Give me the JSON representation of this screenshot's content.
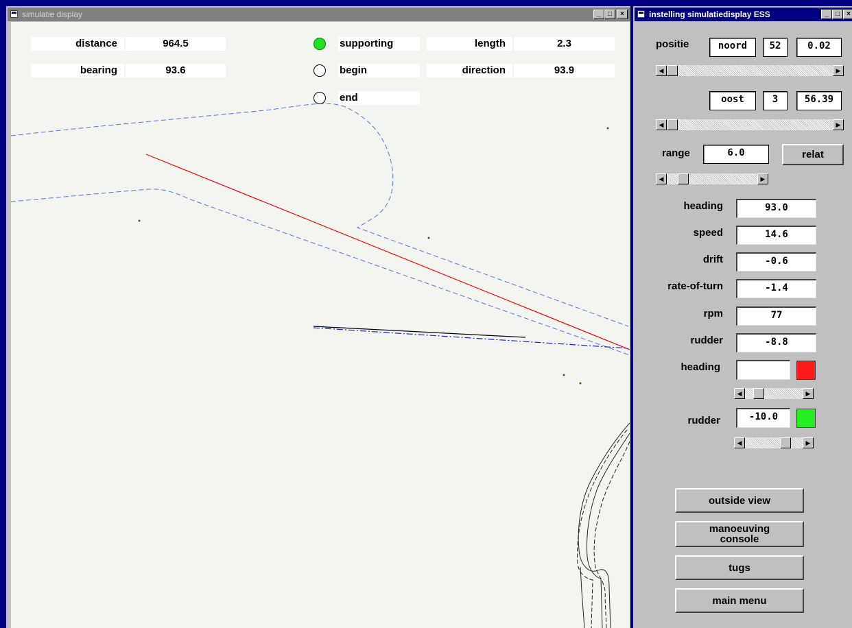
{
  "sim": {
    "title": "simulatie display",
    "info": {
      "distance_label": "distance",
      "distance_value": "964.5",
      "bearing_label": "bearing",
      "bearing_value": "93.6",
      "length_label": "length",
      "length_value": "2.3",
      "direction_label": "direction",
      "direction_value": "93.9"
    },
    "modes": [
      {
        "label": "supporting",
        "selected": true
      },
      {
        "label": "begin",
        "selected": false
      },
      {
        "label": "end",
        "selected": false
      }
    ]
  },
  "settings": {
    "title": "instelling simulatiedisplay ESS",
    "positie_label": "positie",
    "north": {
      "dir": "noord",
      "deg": "52",
      "min": "0.02"
    },
    "east": {
      "dir": "oost",
      "deg": "3",
      "min": "56.39"
    },
    "range_label": "range",
    "range_value": "6.0",
    "relat_button": "relat",
    "readouts": [
      {
        "label": "heading",
        "value": "93.0"
      },
      {
        "label": "speed",
        "value": "14.6"
      },
      {
        "label": "drift",
        "value": "-0.6"
      },
      {
        "label": "rate-of-turn",
        "value": "-1.4"
      },
      {
        "label": "rpm",
        "value": "77"
      },
      {
        "label": "rudder",
        "value": "-8.8"
      }
    ],
    "heading_setting": {
      "label": "heading",
      "value": "",
      "color": "#ff1a1a"
    },
    "rudder_setting": {
      "label": "rudder",
      "value": "-10.0",
      "color": "#22ee22"
    },
    "buttons": {
      "outside_view": "outside view",
      "manoeuving_console": "manoeuving console",
      "tugs": "tugs",
      "main_menu": "main menu"
    }
  },
  "colors": {
    "desktop": "#000080",
    "route": "#ff0000",
    "fairway": "#5a6cf0",
    "selected_mode": "#21e021"
  }
}
